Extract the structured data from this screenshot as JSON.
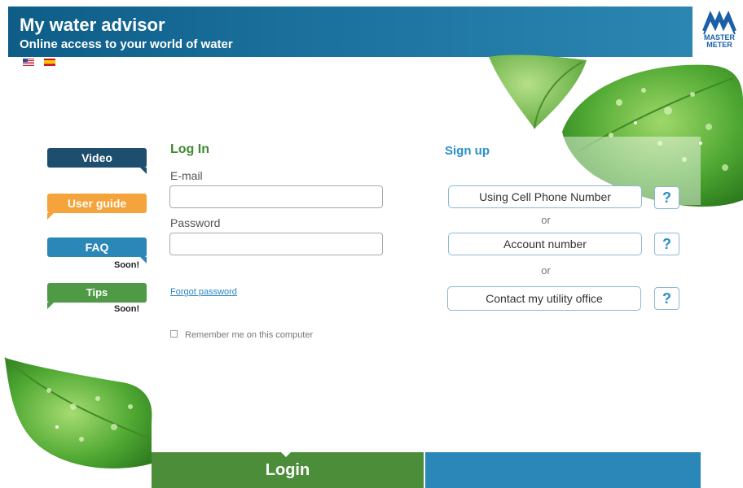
{
  "header": {
    "title": "My water advisor",
    "subtitle": "Online access to your world of water"
  },
  "logo": {
    "line1": "MASTER",
    "line2": "METER",
    "icon": "master-meter-logo"
  },
  "languages": [
    {
      "code": "en",
      "icon": "us-flag-icon"
    },
    {
      "code": "es",
      "icon": "spain-flag-icon"
    }
  ],
  "sidebar": {
    "video": "Video",
    "user_guide": "User guide",
    "faq": "FAQ",
    "faq_note": "Soon!",
    "tips": "Tips",
    "tips_note": "Soon!"
  },
  "login": {
    "heading": "Log In",
    "email_label": "E-mail",
    "email_value": "",
    "password_label": "Password",
    "password_value": "",
    "forgot": "Forgot password",
    "remember": "Remember me on this computer",
    "remember_checked": false,
    "submit": "Login"
  },
  "signup": {
    "heading": "Sign up",
    "cell_phone": "Using Cell Phone Number",
    "or": "or",
    "account_number": "Account number",
    "utility_office": "Contact my utility office",
    "help": "?"
  },
  "colors": {
    "header_blue": "#1a6f9b",
    "login_green": "#4c8d3a",
    "signup_blue": "#2a8fc8",
    "guide_orange": "#f4a43a"
  }
}
